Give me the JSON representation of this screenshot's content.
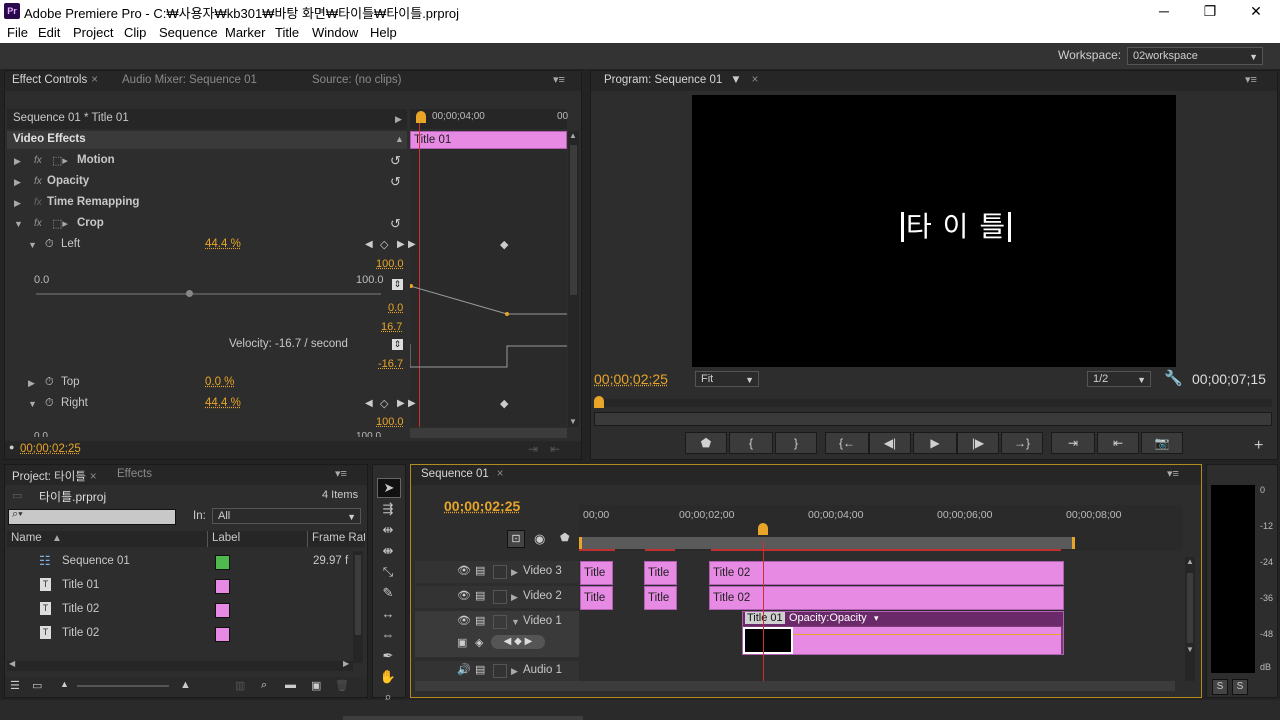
{
  "window": {
    "app_icon": "Pr",
    "title": "Adobe Premiere Pro - C:₩사용자₩kb301₩바탕 화면₩타이틀₩타이틀.prproj",
    "minimize": "─",
    "maximize": "❐",
    "close": "✕"
  },
  "menu": [
    "File",
    "Edit",
    "Project",
    "Clip",
    "Sequence",
    "Marker",
    "Title",
    "Window",
    "Help"
  ],
  "workspace": {
    "label": "Workspace:",
    "value": "02workspace"
  },
  "effect_controls": {
    "tabs": [
      "Effect Controls",
      "Audio Mixer: Sequence 01",
      "Source: (no clips)"
    ],
    "header": "Sequence 01 * Title 01",
    "ruler_time": "00;00;04;00",
    "ruler_end": "00",
    "clip_label": "Title 01",
    "section": "Video Effects",
    "effects": [
      "Motion",
      "Opacity",
      "Time Remapping",
      "Crop"
    ],
    "left": {
      "name": "Left",
      "value": "44.4 %",
      "min": "0.0",
      "max": "100.0",
      "slider_fraction": 0.444
    },
    "graph_value_top": "100.0",
    "graph_value_bottom": "0.0",
    "velocity_top": "16.7",
    "velocity_text": "Velocity: -16.7 / second",
    "velocity_bottom": "-16.7",
    "top": {
      "name": "Top",
      "value": "0.0 %"
    },
    "right": {
      "name": "Right",
      "value": "44.4 %",
      "graph_top": "100.0",
      "min": "0.0",
      "max": "100.0"
    },
    "footer_time": "00;00;02;25"
  },
  "program": {
    "tab": "Program: Sequence 01",
    "title_text": "타 이 틀",
    "timecode": "00;00;02;25",
    "fit": "Fit",
    "resolution": "1/2",
    "duration": "00;00;07;15",
    "transport_icons": [
      "marker-icon",
      "mark-in-icon",
      "mark-out-icon",
      "go-to-in-icon",
      "step-back-icon",
      "play-icon",
      "step-forward-icon",
      "go-to-out-icon",
      "lift-icon",
      "extract-icon",
      "export-frame-icon"
    ],
    "transport_glyphs": [
      "⬟",
      "{",
      "}",
      "{←",
      "◀|",
      "▶",
      "|▶",
      "→}",
      "⇥",
      "⇤",
      "📷"
    ]
  },
  "project": {
    "tabs": [
      "Project: 타이틀",
      "Effects"
    ],
    "file": "타이틀.prproj",
    "items_count": "4 Items",
    "in_label": "In:",
    "in_value": "All",
    "columns": [
      "Name",
      "Label",
      "Frame Rat"
    ],
    "rows": [
      {
        "name": "Sequence 01",
        "label_color": "#4fb84f",
        "frame_rate": "29.97 f"
      },
      {
        "name": "Title 01",
        "label_color": "#e78ae4",
        "frame_rate": ""
      },
      {
        "name": "Title 02",
        "label_color": "#e78ae4",
        "frame_rate": ""
      },
      {
        "name": "Title 02",
        "label_color": "#e78ae4",
        "frame_rate": ""
      }
    ]
  },
  "timeline": {
    "tab": "Sequence 01",
    "timecode": "00;00;02;25",
    "ruler": [
      "00;00",
      "00;00;02;00",
      "00;00;04;00",
      "00;00;06;00",
      "00;00;08;00"
    ],
    "tracks": [
      "Video 3",
      "Video 2",
      "Video 1",
      "Audio 1"
    ],
    "v3_clips": [
      "Title",
      "Title",
      "Title 02"
    ],
    "v2_clips": [
      "Title",
      "Title",
      "Title 02"
    ],
    "v1_clip": "Title 01",
    "v1_opacity": "Opacity:Opacity"
  },
  "meter": {
    "labels": [
      "0",
      "-12",
      "-24",
      "-36",
      "-48",
      "dB"
    ],
    "solo": [
      "S",
      "S"
    ]
  },
  "colors": {
    "accent": "#e8a527",
    "clip": "#e78ae4",
    "playhead": "#d03030"
  }
}
